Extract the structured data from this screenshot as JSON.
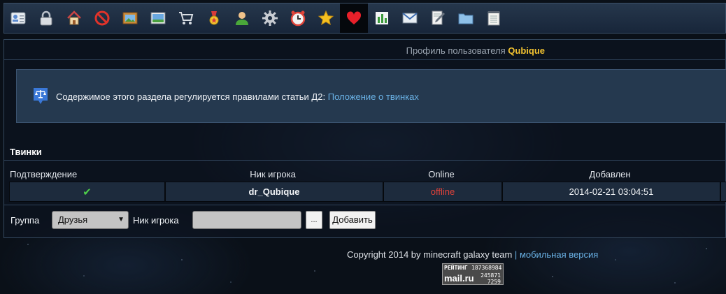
{
  "toolbar": {
    "icons": [
      {
        "name": "contacts-card-icon"
      },
      {
        "name": "padlock-icon"
      },
      {
        "name": "home-icon"
      },
      {
        "name": "ban-icon"
      },
      {
        "name": "picture-frame-icon"
      },
      {
        "name": "landscape-image-icon"
      },
      {
        "name": "shopping-cart-icon"
      },
      {
        "name": "medal-icon"
      },
      {
        "name": "user-icon"
      },
      {
        "name": "gear-icon"
      },
      {
        "name": "alarm-clock-icon"
      },
      {
        "name": "star-icon"
      },
      {
        "name": "heart-icon",
        "active": true
      },
      {
        "name": "bar-chart-icon"
      },
      {
        "name": "envelope-icon"
      },
      {
        "name": "edit-document-icon"
      },
      {
        "name": "folder-icon"
      },
      {
        "name": "notepad-icon"
      }
    ]
  },
  "profile": {
    "prefix": "Профиль пользователя",
    "username": "Qubique"
  },
  "notice": {
    "text": "Содержимое этого раздела регулируется правилами статьи Д2:",
    "link": "Положение о твинках"
  },
  "section": {
    "title": "Твинки"
  },
  "table": {
    "headers": {
      "confirm": "Подтверждение",
      "nick": "Ник игрока",
      "online": "Online",
      "added": "Добавлен"
    },
    "rows": [
      {
        "confirmed": "✔",
        "nick": "dr_Qubique",
        "online": "offline",
        "added": "2014-02-21 03:04:51"
      }
    ]
  },
  "form": {
    "group_label": "Группа",
    "group_value": "Друзья",
    "nick_label": "Ник игрока",
    "nick_value": "",
    "dots_label": "...",
    "add_label": "Добавить"
  },
  "footer": {
    "copyright": "Copyright 2014 by minecraft galaxy team",
    "separator": "|",
    "mobile_link": "мобильная версия"
  },
  "counter": {
    "label": "РЕЙТИНГ",
    "brand": "mail.ru",
    "value1": "187368984",
    "value2": "245871",
    "value3": "7259"
  },
  "colors": {
    "username": "#f2c230",
    "link": "#6ab2e6",
    "offline": "#e0423a",
    "check": "#4fcf4a"
  }
}
